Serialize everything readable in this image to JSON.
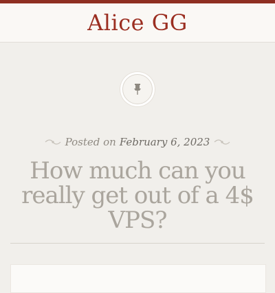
{
  "site": {
    "title": "Alice GG"
  },
  "post": {
    "posted_prefix": "Posted on",
    "date": "February 6, 2023",
    "title": "How much can you really get out of a 4$ VPS?"
  },
  "icons": {
    "format": "pin-icon"
  },
  "colors": {
    "accent": "#9b2e21",
    "top_bar": "#8e2f22",
    "background": "#f1efeb"
  }
}
